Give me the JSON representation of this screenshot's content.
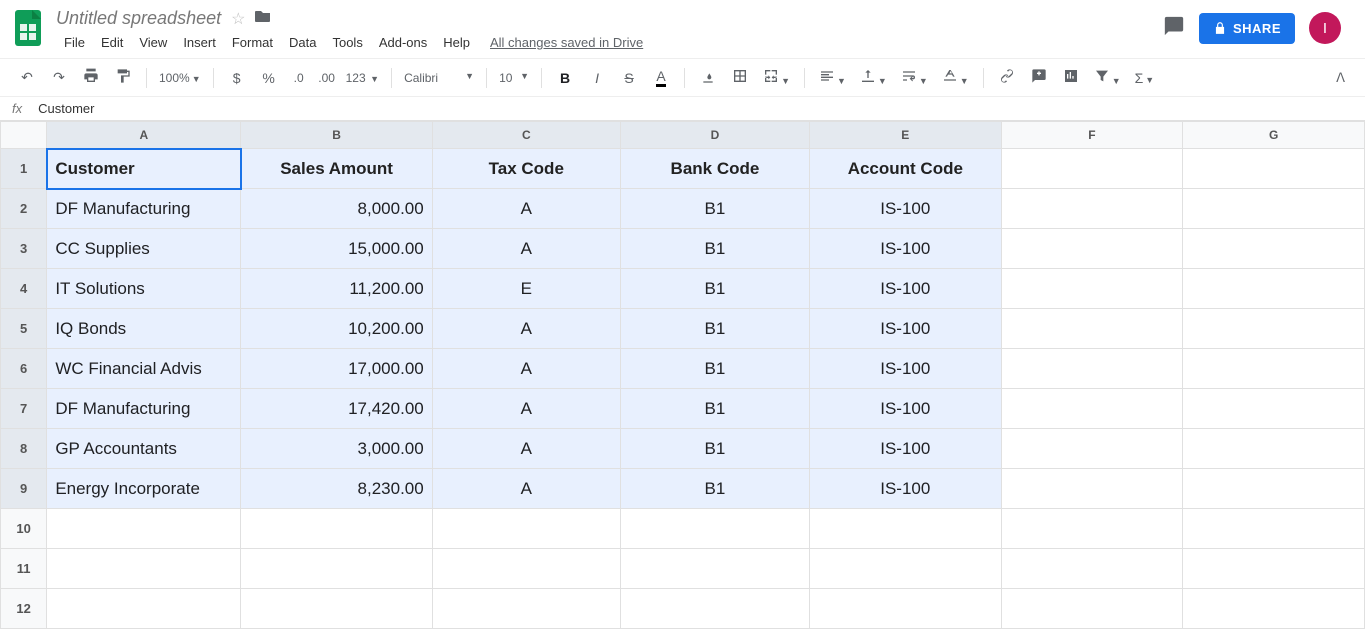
{
  "doc": {
    "title": "Untitled spreadsheet",
    "save_status": "All changes saved in Drive"
  },
  "menus": [
    "File",
    "Edit",
    "View",
    "Insert",
    "Format",
    "Data",
    "Tools",
    "Add-ons",
    "Help"
  ],
  "share_label": "SHARE",
  "avatar_letter": "I",
  "toolbar": {
    "zoom": "100%",
    "font": "Calibri",
    "size": "10",
    "currency": "$",
    "percent": "%",
    "dec_dec": ".0",
    "dec_inc": ".00",
    "num_fmt": "123"
  },
  "fx": {
    "value": "Customer"
  },
  "columns": [
    "A",
    "B",
    "C",
    "D",
    "E",
    "F",
    "G"
  ],
  "row_count": 12,
  "header_row": [
    "Customer",
    "Sales Amount",
    "Tax Code",
    "Bank Code",
    "Account Code"
  ],
  "data_rows": [
    [
      "DF Manufacturing",
      "8,000.00",
      "A",
      "B1",
      "IS-100"
    ],
    [
      "CC Supplies",
      "15,000.00",
      "A",
      "B1",
      "IS-100"
    ],
    [
      "IT Solutions",
      "11,200.00",
      "E",
      "B1",
      "IS-100"
    ],
    [
      "IQ Bonds",
      "10,200.00",
      "A",
      "B1",
      "IS-100"
    ],
    [
      "WC Financial Advis",
      "17,000.00",
      "A",
      "B1",
      "IS-100"
    ],
    [
      "DF Manufacturing",
      "17,420.00",
      "A",
      "B1",
      "IS-100"
    ],
    [
      "GP Accountants",
      "3,000.00",
      "A",
      "B1",
      "IS-100"
    ],
    [
      "Energy Incorporate",
      "8,230.00",
      "A",
      "B1",
      "IS-100"
    ]
  ],
  "active_col": 0,
  "selection": {
    "rows": [
      1,
      9
    ],
    "cols": [
      0,
      4
    ]
  }
}
